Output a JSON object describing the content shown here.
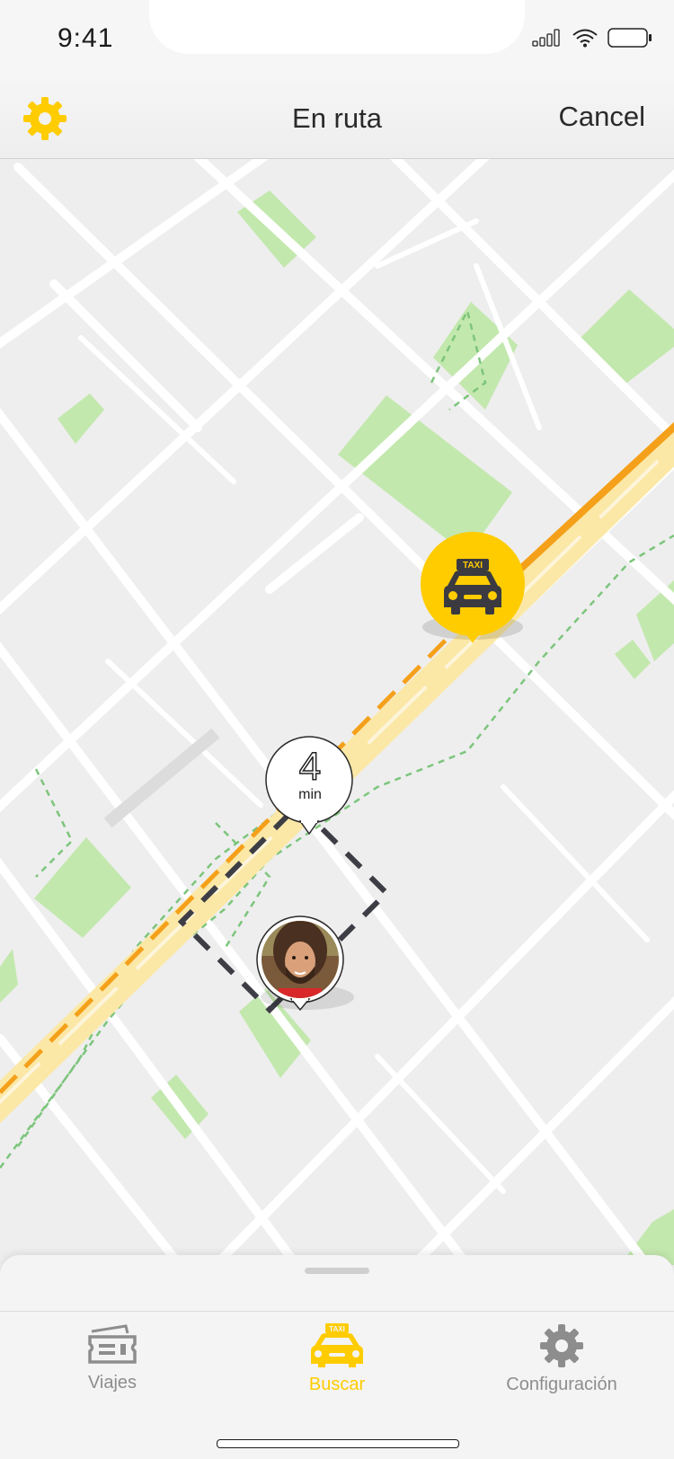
{
  "status_bar": {
    "time": "9:41"
  },
  "nav": {
    "title": "En ruta",
    "cancel_label": "Cancel"
  },
  "map": {
    "eta_value": "4",
    "eta_unit": "min",
    "taxi_badge_text": "TAXI"
  },
  "tabs": [
    {
      "label": "Viajes",
      "icon": "ticket-icon",
      "active": false
    },
    {
      "label": "Buscar",
      "icon": "taxi-icon",
      "active": true
    },
    {
      "label": "Configuración",
      "icon": "gear-icon",
      "active": false
    }
  ],
  "colors": {
    "accent": "#ffcc00",
    "route_orange": "#f5a01a",
    "route_yellow": "#fbe8a6",
    "park_green": "#c3e8ae",
    "map_bg": "#efefef",
    "icon_dark": "#3a3a40"
  }
}
